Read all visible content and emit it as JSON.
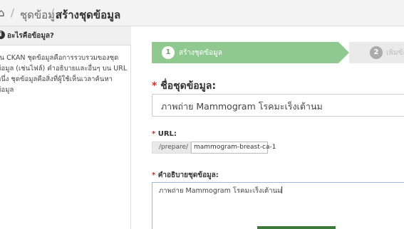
{
  "breadcrumb": {
    "home_icon": "home-icon",
    "home_glyph": "⌂",
    "separator": "/",
    "item": "ชุดข้อมูล",
    "active": "สร้างชุดข้อมูล"
  },
  "sidebar": {
    "info_icon": "info-icon",
    "title": "อะไรคือข้อมูล?",
    "text": "ใน CKAN ชุดข้อมูลคือการรวบรวมของชุดข้อมูล (เช่นไฟล์) คำอธิบายและอื่นๆ บน URL หนึ่ง ชุดข้อมูลคือสิ่งที่ผู้ใช้เห็นเวลาค้นหาข้อมูล"
  },
  "stages": {
    "step1_number": "1",
    "step1_label": "สร้างชุดข้อมูล",
    "step2_number": "2",
    "step2_label": "เพิ่มข้อมูล"
  },
  "form": {
    "required_mark": "*",
    "title_label": "ชื่อชุดข้อมูล:",
    "title_value": "ภาพถ่าย Mammogram โรคมะเร็งเต้านม",
    "url_label": "URL:",
    "url_prefix": "/prepare/",
    "url_value": "mammogram-breast-ca-1",
    "description_label": "คำอธิบายชุดข้อมูล:",
    "description_value": "ภาพถ่าย Mammogram โรคมะเร็งเต้านม"
  },
  "colors": {
    "stage_active": "#8fc98f",
    "required": "#c9302c",
    "textarea_focus": "#9ab7d6"
  }
}
